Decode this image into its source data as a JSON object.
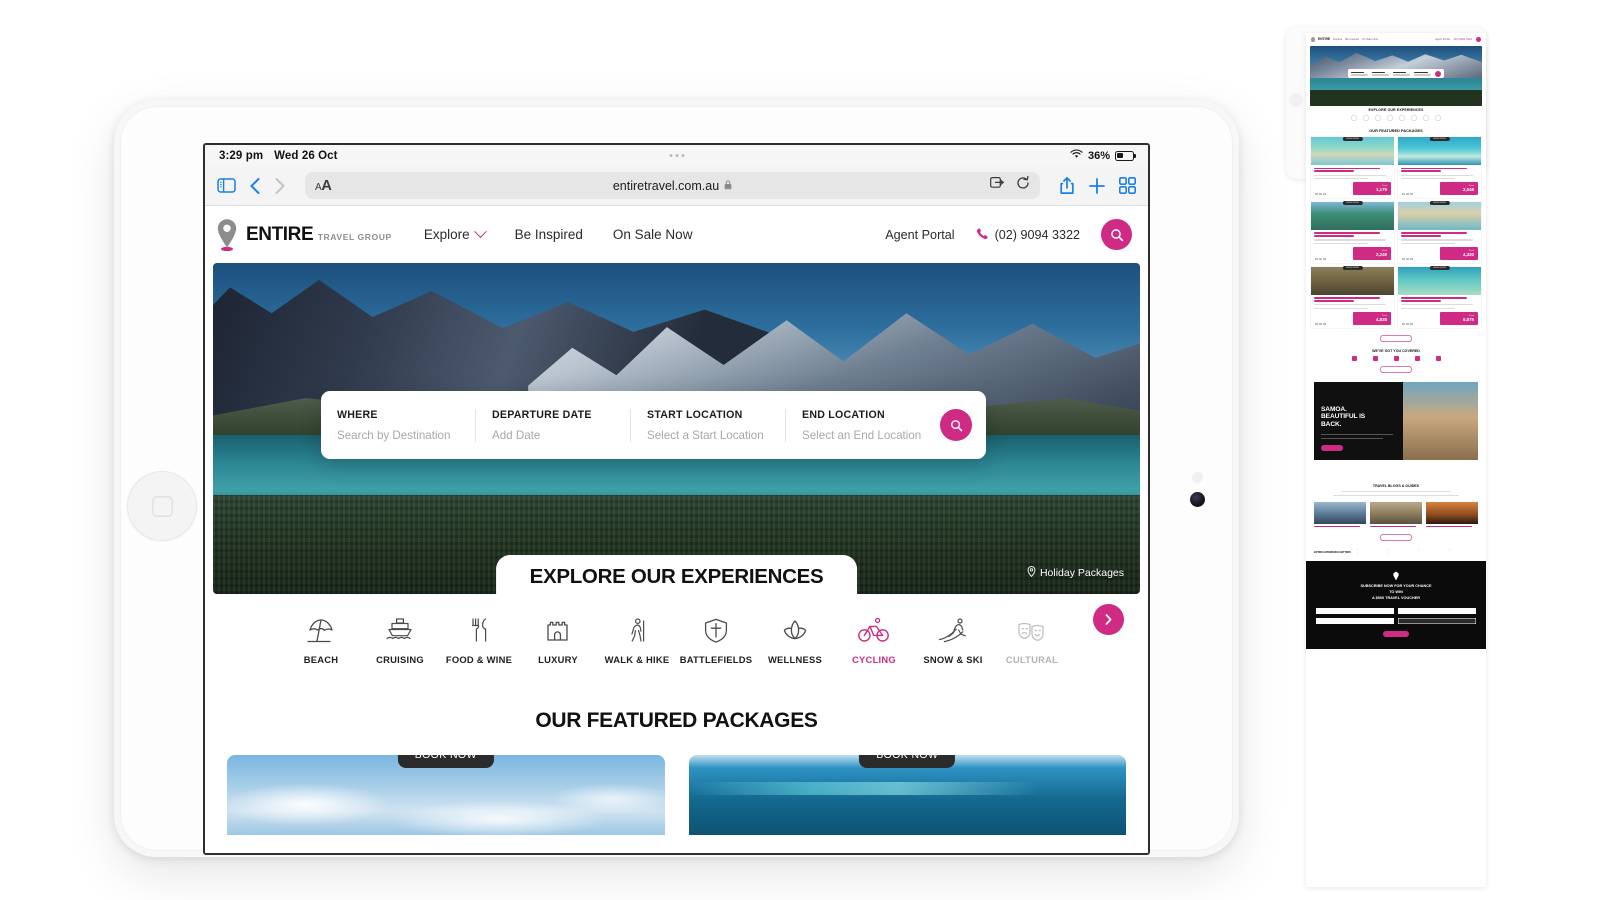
{
  "statusbar": {
    "time": "3:29 pm",
    "date": "Wed 26 Oct",
    "battery_percent": "36%",
    "wifi_icon": "wifi-icon",
    "battery_icon": "battery-icon"
  },
  "browser": {
    "sidebar_icon": "sidebar-icon",
    "back_icon": "chevron-left-icon",
    "forward_icon": "chevron-right-icon",
    "aa_label": "ᴀA",
    "url": "entiretravel.com.au",
    "lock_icon": "lock-icon",
    "extensions_icon": "extensions-icon",
    "reload_icon": "reload-icon",
    "share_icon": "share-icon",
    "newtab_icon": "plus-icon",
    "tabs_icon": "tab-overview-icon"
  },
  "site": {
    "brand": {
      "name": "ENTIRE",
      "tagline": "TRAVEL GROUP",
      "pin_icon": "map-pin-icon"
    },
    "nav_links": [
      {
        "label": "Explore",
        "has_dropdown": true,
        "icon": "chevron-down-icon"
      },
      {
        "label": "Be Inspired",
        "has_dropdown": false
      },
      {
        "label": "On Sale Now",
        "has_dropdown": false
      }
    ],
    "nav_right": {
      "agent_portal": "Agent Portal",
      "phone": "(02) 9094 3322",
      "phone_icon": "phone-icon",
      "search_icon": "search-icon"
    },
    "hero": {
      "geotag": "Holiday Packages",
      "geotag_icon": "map-pin-icon",
      "banner_title": "EXPLORE OUR EXPERIENCES"
    },
    "search_widget": {
      "fields": [
        {
          "label": "WHERE",
          "placeholder": "Search by Destination"
        },
        {
          "label": "DEPARTURE DATE",
          "placeholder": "Add Date"
        },
        {
          "label": "START LOCATION",
          "placeholder": "Select a Start Location"
        },
        {
          "label": "END LOCATION",
          "placeholder": "Select an End Location"
        }
      ],
      "submit_icon": "search-icon"
    },
    "categories": [
      {
        "label": "BEACH",
        "icon": "beach-umbrella-icon",
        "state": "normal"
      },
      {
        "label": "CRUISING",
        "icon": "cruise-ship-icon",
        "state": "normal"
      },
      {
        "label": "FOOD & WINE",
        "icon": "fork-knife-icon",
        "state": "normal"
      },
      {
        "label": "LUXURY",
        "icon": "castle-icon",
        "state": "normal"
      },
      {
        "label": "WALK & HIKE",
        "icon": "hiker-icon",
        "state": "normal"
      },
      {
        "label": "BATTLEFIELDS",
        "icon": "shield-cross-icon",
        "state": "normal"
      },
      {
        "label": "WELLNESS",
        "icon": "lotus-icon",
        "state": "normal"
      },
      {
        "label": "CYCLING",
        "icon": "bicycle-icon",
        "state": "active"
      },
      {
        "label": "SNOW & SKI",
        "icon": "skier-icon",
        "state": "normal"
      },
      {
        "label": "CULTURAL",
        "icon": "theatre-masks-icon",
        "state": "faded"
      }
    ],
    "categories_next_icon": "chevron-right-icon",
    "featured": {
      "title": "OUR FEATURED PACKAGES",
      "cards": [
        {
          "badge": "BOOK NOW"
        },
        {
          "badge": "BOOK NOW"
        }
      ]
    },
    "accent_color": "#cf2a84"
  },
  "thumbnail": {
    "brand": "ENTIRE",
    "explore_banner": "EXPLORE OUR EXPERIENCES",
    "featured_title": "OUR FEATURED PACKAGES",
    "covered_title": "WE'VE GOT YOU COVERED",
    "blogs_title": "TRAVEL BLOGS & GUIDES",
    "samoa": {
      "line1": "SAMOA.",
      "line2": "BEAUTIFUL IS",
      "line3": "BACK."
    },
    "packages": [
      {
        "price": "1,179",
        "badge": "BOOK NOW"
      },
      {
        "price": "2,048",
        "badge": "BOOK NOW"
      },
      {
        "price": "2,249",
        "badge": "BOOK NOW"
      },
      {
        "price": "4,320",
        "badge": "BOOK NOW"
      },
      {
        "price": "4,838",
        "badge": "BOOK NOW"
      },
      {
        "price": "6,875",
        "badge": "BOOK NOW"
      }
    ],
    "price_prefix": "From",
    "subscribe": {
      "line1": "SUBSCRIBE NOW FOR YOUR CHANCE",
      "line2": "TO WIN",
      "line3": "A $500 TRAVEL VOUCHER"
    },
    "footer_label": "ENTIRE EXPERIENCE MATTERS"
  }
}
